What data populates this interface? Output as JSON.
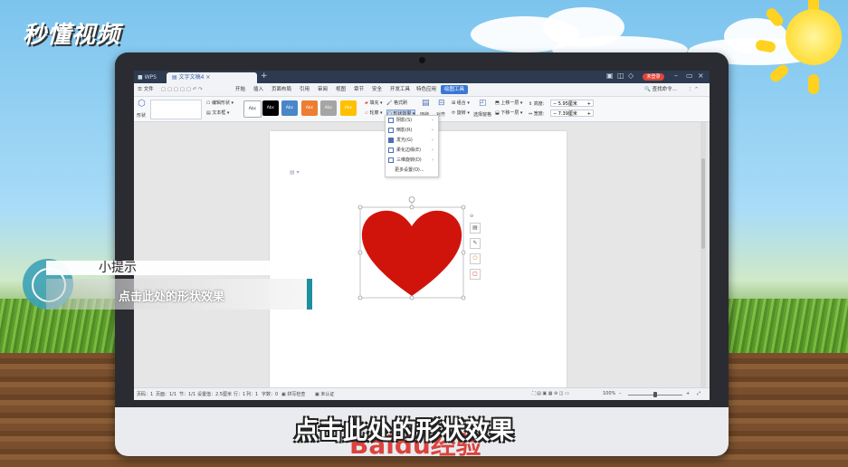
{
  "overlay": {
    "logo": "秒懂视频",
    "tip_title": "小提示",
    "tip_body": "点击此处的形状效果",
    "subtitle": "点击此处的形状效果",
    "watermark": "Baidu经验"
  },
  "window": {
    "app_tab": "WPS",
    "doc_tab": "文字文稿4",
    "login_label": "未登录"
  },
  "menu": {
    "file": "文件",
    "items": [
      "开始",
      "插入",
      "页面布局",
      "引用",
      "审阅",
      "视图",
      "章节",
      "安全",
      "开发工具",
      "特色应用"
    ],
    "active": "绘图工具",
    "search": "查找命令..."
  },
  "toolbar": {
    "shape_label": "形状",
    "edit_shape": "编辑形状",
    "textbox": "文本框",
    "style_label": "Abc",
    "fill": "填充",
    "outline": "轮廓",
    "format_painter": "格式刷",
    "shape_effect": "形状效果",
    "wrap": "环绕",
    "align": "对齐",
    "group": "组合",
    "rotate": "旋转",
    "select_pane": "选择窗格",
    "bring_forward": "上移一层",
    "send_backward": "下移一层",
    "height_label": "高度:",
    "height_value": "5.95厘米",
    "width_label": "宽度:",
    "width_value": "7.39厘米"
  },
  "style_colors": [
    "#ffffff",
    "#000000",
    "#4a86c8",
    "#ed7d31",
    "#a5a5a5",
    "#ffc000"
  ],
  "dropdown": {
    "items": [
      {
        "label": "阴影(S)"
      },
      {
        "label": "倒影(R)"
      },
      {
        "label": "发光(G)"
      },
      {
        "label": "柔化边缘(E)"
      },
      {
        "label": "三维旋转(D)"
      },
      {
        "label": "更多设置(O)..."
      }
    ]
  },
  "shape": {
    "fill": "#d0140c"
  },
  "status": {
    "page": "页码：1",
    "pages": "页面：1/1",
    "section": "节：1/1",
    "setting": "设置值：2.5厘米",
    "row": "行：1",
    "col": "列：1",
    "words": "字数：0",
    "spell": "拼写检查",
    "auth": "未认证",
    "zoom": "100%"
  }
}
